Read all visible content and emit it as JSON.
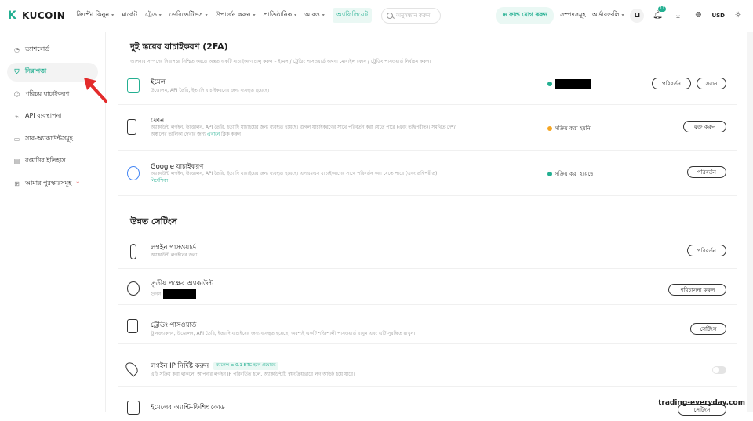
{
  "header": {
    "logo_text": "KUCOIN",
    "nav": [
      {
        "label": "ক্রিপ্টো কিনুন",
        "caret": true
      },
      {
        "label": "মার্কেট",
        "caret": false
      },
      {
        "label": "ট্রেড",
        "caret": true
      },
      {
        "label": "ডেরিভেটিভস",
        "caret": true
      },
      {
        "label": "উপার্জন করুন",
        "caret": true
      },
      {
        "label": "প্রাতিষ্ঠানিক",
        "caret": true
      },
      {
        "label": "আরও",
        "caret": true
      }
    ],
    "highlight_link": "অ্যাফিলিয়েট",
    "search_placeholder": "অনুসন্ধান করুন",
    "deposit_label": "ফান্ড যোগ করুন",
    "assets_label": "সম্পদসমূহ",
    "orders_label": "অর্ডারগুলি",
    "avatar_initials": "LI",
    "notification_count": "11",
    "currency": "USD"
  },
  "sidebar": {
    "items": [
      {
        "label": "ড্যাশবোর্ড",
        "icon": "dashboard-icon",
        "active": false
      },
      {
        "label": "নিরাপত্তা",
        "icon": "shield-icon",
        "active": true
      },
      {
        "label": "পরিচয় যাচাইকরণ",
        "icon": "user-icon",
        "active": false
      },
      {
        "label": "API ব্যবস্থাপনা",
        "icon": "api-icon",
        "active": false
      },
      {
        "label": "সাব-অ্যাকাউন্টসমূহ",
        "icon": "subaccount-icon",
        "active": false
      },
      {
        "label": "রপ্তানির ইতিহাস",
        "icon": "export-icon",
        "active": false
      },
      {
        "label": "আমার পুরস্কারসমূহ",
        "icon": "gift-icon",
        "active": false,
        "star": "*"
      }
    ]
  },
  "twofa": {
    "title": "দুই স্তরের যাচাইকরণ (2FA)",
    "subtitle": "আপনার সম্পদের নিরাপত্তা নিশ্চিত করতে অন্তত একটি যাচাইকরণ চালু করুন – ইমেল / ট্রেডিং পাসওয়ার্ড অথবা মোবাইল ফোন / ট্রেডিং পাসওয়ার্ড নির্বাচন করুন।",
    "rows": [
      {
        "title": "ইমেল",
        "desc": "উত্তোলন, API তৈরি, ইত্যাদি যাচাইকরণের জন্য ব্যবহৃত হয়েছে।",
        "status": "",
        "buttons": [
          "পরিবর্তন",
          "সরান"
        ]
      },
      {
        "title": "ফোন",
        "desc": "অ্যাকাউন্ট লগইন, উত্তোলন, API তৈরি, ইত্যাদি যাচাইয়ের জন্য ব্যবহৃত হয়েছে। গুগল যাচাইকরণের সাথে পরিবর্তন করা যেতে পারে (এবং তদ্বিপরীত)। সমর্থিত দেশ/",
        "desc2_prefix": "অঞ্চলের তালিকা দেখার জন্য ",
        "desc2_link": "এখানে",
        "desc2_suffix": " ক্লিক করুন।",
        "status": "সক্রিয় করা হয়নি",
        "buttons": [
          "যুক্ত করুন"
        ]
      },
      {
        "title": "Google যাচাইকরণ",
        "desc": "অ্যাকাউন্ট লগইন, উত্তোলন, API তৈরি, ইত্যাদি যাচাইয়ের জন্য ব্যবহৃত হয়েছে। এসএমএস যাচাইকরণের সাথে পরিবর্তন করা যেতে পারে (এবং তদ্বিপরীত)।",
        "link": "নির্দেশিকা",
        "status": "সক্রিয় করা হয়েছে",
        "buttons": [
          "পরিবর্তন"
        ]
      }
    ]
  },
  "advanced": {
    "title": "উন্নত সেটিংস",
    "rows": [
      {
        "title": "লগইন পাসওয়ার্ড",
        "desc": "অ্যাকাউন্ট লগইনের জন্য।",
        "buttons": [
          "পরিবর্তন"
        ]
      },
      {
        "title": "তৃতীয় পক্ষের অ্যাকাউন্ট",
        "desc": "গুগল",
        "buttons": [
          "পরিচালনা করুন"
        ]
      },
      {
        "title": "ট্রেডিং পাসওয়ার্ড",
        "desc": "ট্রানজ্যাকশন, উত্তোলন, API তৈরি, ইত্যাদি যাচাইয়ের জন্য ব্যবহৃত হয়েছে। অবশ্যই একটি শক্তিশালী পাসওয়ার্ড রাখুন এবং এটি সুরক্ষিত রাখুন।",
        "buttons": [
          "সেটিংস"
        ]
      },
      {
        "title": "লগইন IP নির্দিষ্ট করুন",
        "tag": "ব্যালেন্স ≥ 0.1 BTC হলে প্রযোজ্য",
        "desc": "এটি সক্রিয় করা থাকলে, আপনার লগইন IP পরিবর্তিত হলে, অ্যাকাউন্টটি স্বয়ংক্রিয়ভাবে লগ আউট হয়ে যাবে।"
      },
      {
        "title": "ইমেলের অ্যান্টি-ফিশিং কোড",
        "buttons": [
          "সেটিংস"
        ]
      }
    ]
  },
  "watermark": "trading-everyday.com",
  "colors": {
    "accent": "#23af91",
    "warning": "#f5a623",
    "annotation_arrow": "#e32b2b"
  }
}
